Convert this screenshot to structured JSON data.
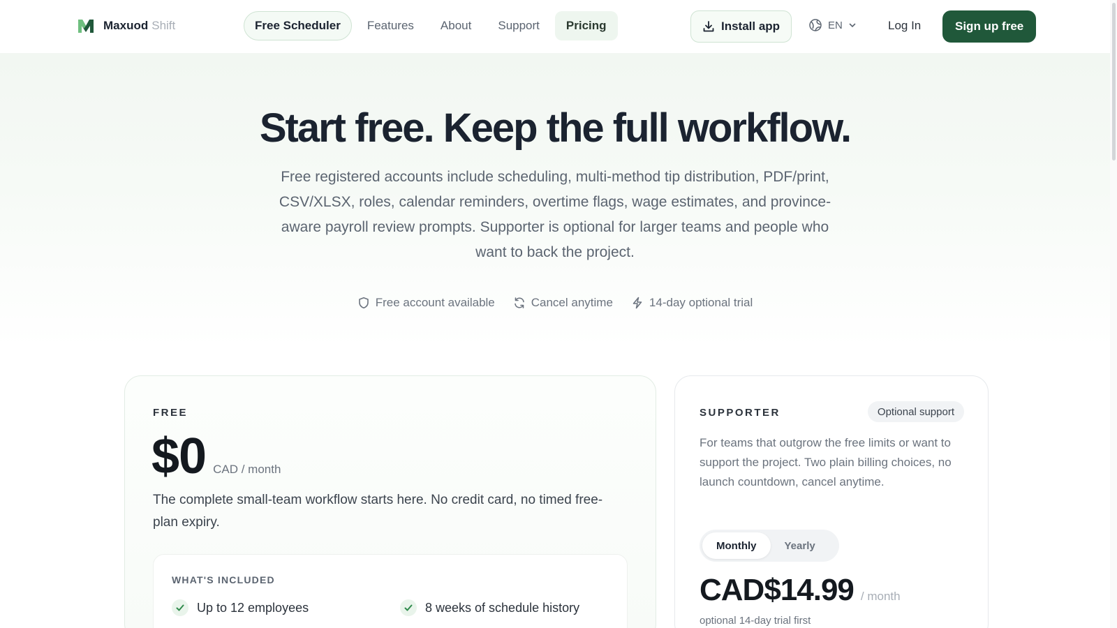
{
  "brand": {
    "name": "Maxuod",
    "suffix": "Shift"
  },
  "nav": {
    "items": [
      {
        "label": "Free Scheduler"
      },
      {
        "label": "Features"
      },
      {
        "label": "About"
      },
      {
        "label": "Support"
      },
      {
        "label": "Pricing"
      }
    ]
  },
  "header": {
    "install_label": "Install app",
    "language": "EN",
    "login_label": "Log In",
    "signup_label": "Sign up free"
  },
  "hero": {
    "title": "Start free. Keep the full workflow.",
    "description": "Free registered accounts include scheduling, multi-method tip distribution, PDF/print, CSV/XLSX, roles, calendar reminders, overtime flags, wage estimates, and province-aware payroll review prompts. Supporter is optional for larger teams and people who want to back the project.",
    "badges": [
      {
        "icon": "shield-icon",
        "label": "Free account available"
      },
      {
        "icon": "refresh-icon",
        "label": "Cancel anytime"
      },
      {
        "icon": "lightning-icon",
        "label": "14-day optional trial"
      }
    ]
  },
  "free_plan": {
    "eyebrow": "FREE",
    "price": "$0",
    "unit": "CAD / month",
    "description": "The complete small-team workflow starts here. No credit card, no timed free-plan expiry.",
    "included_title": "WHAT'S INCLUDED",
    "features": [
      {
        "label": "Up to 12 employees"
      },
      {
        "label": "8 weeks of schedule history"
      }
    ]
  },
  "supporter_plan": {
    "eyebrow": "SUPPORTER",
    "pill": "Optional support",
    "description": "For teams that outgrow the free limits or want to support the project. Two plain billing choices, no launch countdown, cancel anytime.",
    "toggle": {
      "monthly": "Monthly",
      "yearly": "Yearly"
    },
    "price": "CAD$14.99",
    "unit": "/ month",
    "note": "optional 14-day trial first"
  },
  "colors": {
    "brand_green": "#20583a",
    "accent_light": "#eef6ef"
  }
}
